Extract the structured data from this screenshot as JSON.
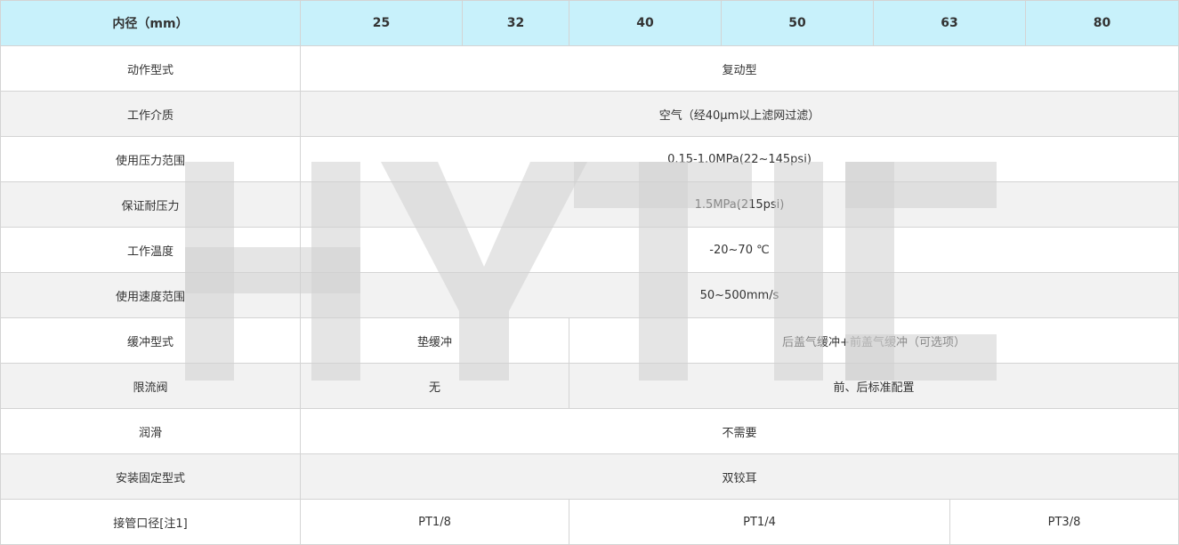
{
  "header": {
    "label": "内径（mm）",
    "bores": [
      "25",
      "32",
      "40",
      "50",
      "63",
      "80"
    ]
  },
  "rows": [
    {
      "label": "动作型式",
      "cells": [
        {
          "text": "复动型",
          "span": "all"
        }
      ]
    },
    {
      "label": "工作介质",
      "cells": [
        {
          "text": "空气（经40μm以上滤网过滤）",
          "span": "all"
        }
      ]
    },
    {
      "label": "使用压力范围",
      "cells": [
        {
          "text": "0.15-1.0MPa(22~145psi)",
          "span": "all"
        }
      ]
    },
    {
      "label": "保证耐压力",
      "cells": [
        {
          "text": "1.5MPa(215psi)",
          "span": "all"
        }
      ]
    },
    {
      "label": "工作温度",
      "cells": [
        {
          "text": "-20~70 ℃",
          "span": "all"
        }
      ]
    },
    {
      "label": "使用速度范围",
      "cells": [
        {
          "text": "50~500mm/s",
          "span": "all"
        }
      ]
    },
    {
      "label": "缓冲型式",
      "cells": [
        {
          "text": "垫缓冲",
          "span": "25-32"
        },
        {
          "text": "后盖气缓冲+前盖气缓冲（可选项）",
          "span": "40-80"
        }
      ]
    },
    {
      "label": "限流阀",
      "cells": [
        {
          "text": "无",
          "span": "25-32"
        },
        {
          "text": "前、后标准配置",
          "span": "40-80"
        }
      ]
    },
    {
      "label": "润滑",
      "cells": [
        {
          "text": "不需要",
          "span": "all"
        }
      ]
    },
    {
      "label": "安装固定型式",
      "cells": [
        {
          "text": "双铰耳",
          "span": "all"
        }
      ]
    },
    {
      "label": "接管口径[注1]",
      "cells": [
        {
          "text": "PT1/8",
          "span": "25-32"
        },
        {
          "text": "PT1/4",
          "span": "40-63"
        },
        {
          "text": "PT3/8",
          "span": "80"
        }
      ]
    }
  ],
  "watermark": {
    "text": "HYTIC",
    "color": "#cfcfcf"
  },
  "colors": {
    "header_bg": "#c8f1fb",
    "row_alt_bg": "#f2f2f2",
    "border": "#d4d4d4",
    "text": "#333333"
  }
}
